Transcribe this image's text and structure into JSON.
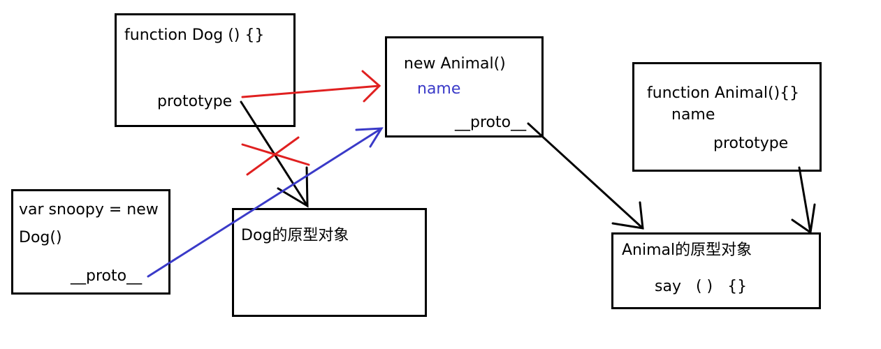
{
  "dog_function": {
    "title": "function Dog () {}",
    "prototype_label": "prototype"
  },
  "new_animal": {
    "title": "new Animal()",
    "name_label": "name",
    "proto_label": "__proto__"
  },
  "animal_function": {
    "title": "function Animal(){}",
    "name_label": "name",
    "prototype_label": "prototype"
  },
  "snoopy": {
    "line1": "var snoopy = new",
    "line2": "Dog()",
    "proto_label": "__proto__"
  },
  "dog_prototype": {
    "title": "Dog的原型对象"
  },
  "animal_prototype": {
    "title": "Animal的原型对象",
    "method_label": "say   ( )   {}"
  },
  "colors": {
    "stroke": "#000000",
    "red_arrow": "#e02020",
    "blue_arrow": "#3a3ac8"
  }
}
